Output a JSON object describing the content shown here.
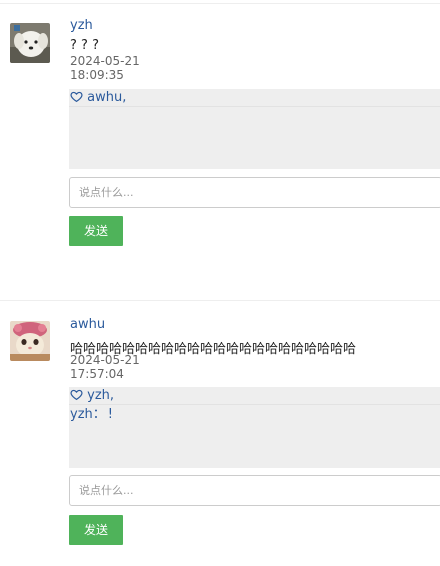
{
  "posts": [
    {
      "author": "yzh",
      "content": "? ? ?",
      "date": "2024-05-21",
      "time": "18:09:35",
      "likes": "awhu,",
      "comments": [],
      "input_placeholder": "说点什么...",
      "send_label": "发送"
    },
    {
      "author": "awhu",
      "content": "哈哈哈哈哈哈哈哈哈哈哈哈哈哈哈哈哈哈哈哈哈哈",
      "date": "2024-05-21",
      "time": "17:57:04",
      "likes": "yzh,",
      "comments": [
        {
          "user": "yzh",
          "separator": "：",
          "text": "!"
        }
      ],
      "input_placeholder": "说点什么...",
      "send_label": "发送"
    }
  ],
  "icons": {
    "like": "heart-outline-icon"
  }
}
